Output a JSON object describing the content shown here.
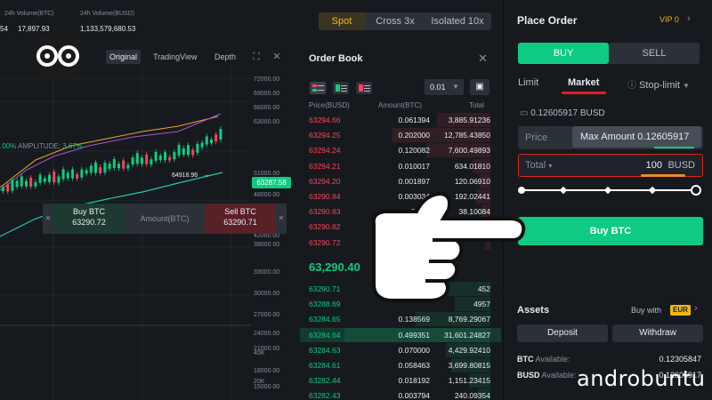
{
  "stats": {
    "change_fragment": "54",
    "low_label": "24h Volume(BTC)",
    "low_value": "17,897.93",
    "vol_label": "24h Volume(BUSD)",
    "vol_value": "1,133,579,680.53"
  },
  "chart_toolbar": {
    "tabs": [
      "Original",
      "TradingView",
      "Depth"
    ],
    "active_tab": "Original"
  },
  "chart": {
    "amplitude_prefix": ".00%",
    "amplitude_label": "AMPLITUDE:",
    "amplitude_value": "3.67%",
    "high_label": "64918.96",
    "last_price": "63287.58",
    "price_labels": [
      "72000.00",
      "69000.00",
      "66000.00",
      "63000.00",
      "51000.00",
      "48000.00",
      "45000.00",
      "42000.00",
      "39000.00",
      "33000.00",
      "30000.00",
      "27000.00",
      "24000.00",
      "21000.00",
      "18000.00",
      "15000.00",
      "40K",
      "20K"
    ],
    "quick_trade": {
      "buy_label": "Buy BTC",
      "buy_price": "63290.72",
      "amount_placeholder": "Amount(BTC)",
      "sell_label": "Sell BTC",
      "sell_price": "63290.71"
    }
  },
  "mode_tabs": [
    {
      "label": "Spot",
      "active": true
    },
    {
      "label": "Cross 3x",
      "active": false
    },
    {
      "label": "Isolated 10x",
      "active": false
    }
  ],
  "order_book": {
    "title": "Order Book",
    "precision": "0.01",
    "headers": [
      "Price(BUSD)",
      "Amount(BTC)",
      "Total"
    ],
    "mid_price": "63,290.40",
    "asks": [
      {
        "price": "63294.66",
        "amount": "0.061394",
        "total": "3,885.91236",
        "depth": 0.3
      },
      {
        "price": "63294.25",
        "amount": "0.202000",
        "total": "12,785.43850",
        "depth": 0.55
      },
      {
        "price": "63294.24",
        "amount": "0.120082",
        "total": "7,600.49893",
        "depth": 0.36
      },
      {
        "price": "63294.21",
        "amount": "0.010017",
        "total": "634.01810",
        "depth": 0.1
      },
      {
        "price": "63294.20",
        "amount": "0.001897",
        "total": "120.06910",
        "depth": 0.06
      },
      {
        "price": "63290.84",
        "amount": "0.003034",
        "total": "192.02441",
        "depth": 0.08
      },
      {
        "price": "63290.83",
        "amount": "0.001",
        "total": "38.10084",
        "depth": 0.05
      },
      {
        "price": "63290.82",
        "amount": "",
        "total": "",
        "depth": 0.04
      },
      {
        "price": "63290.72",
        "amount": "",
        "total": "",
        "depth": 0.03
      }
    ],
    "bids": [
      {
        "price": "63290.71",
        "amount": "",
        "total": "452",
        "depth": 0.35
      },
      {
        "price": "63288.69",
        "amount": "",
        "total": "4957",
        "depth": 0.2
      },
      {
        "price": "63284.65",
        "amount": "0.138569",
        "total": "8,769.29067",
        "depth": 0.42
      },
      {
        "price": "63284.64",
        "amount": "0.499351",
        "total": "31,601.24827",
        "depth": 0.82,
        "highlight": true
      },
      {
        "price": "63284.63",
        "amount": "0.070000",
        "total": "4,429.92410",
        "depth": 0.25
      },
      {
        "price": "63284.61",
        "amount": "0.058463",
        "total": "3,699.80815",
        "depth": 0.22
      },
      {
        "price": "63282.44",
        "amount": "0.018192",
        "total": "1,151.23415",
        "depth": 0.12
      },
      {
        "price": "63282.43",
        "amount": "0.003794",
        "total": "240.09354",
        "depth": 0.07
      }
    ]
  },
  "place_order": {
    "title": "Place Order",
    "vip": "VIP 0",
    "buy_tab": "BUY",
    "sell_tab": "SELL",
    "order_types": [
      "Limit",
      "Market",
      "Stop-limit"
    ],
    "active_order_type": "Market",
    "available": "0.12605917 BUSD",
    "price_label": "Price",
    "max_amount_tip": "Max Amount 0.12605917",
    "total_label": "Total",
    "total_value": "100",
    "total_unit": "BUSD",
    "slider_percent": 100,
    "buy_button": "Buy BTC"
  },
  "assets": {
    "title": "Assets",
    "buy_with": "Buy with",
    "currency": "EUR",
    "deposit": "Deposit",
    "withdraw": "Withdraw",
    "btc_label": "BTC",
    "btc_available_label": "Available:",
    "btc_value": "0.12305847",
    "busd_label": "BUSD",
    "busd_available_label": "Available:",
    "busd_value": "0.12605917"
  },
  "watermark": "androbuntu",
  "colors": {
    "background": "#161a1e",
    "green": "#0ecb81",
    "red": "#f6465d",
    "yellow": "#f0b90b",
    "panel": "#2b3139"
  },
  "icons": [
    "logo-icon",
    "expand-icon",
    "close-icon",
    "view-both-icon",
    "view-bids-icon",
    "view-asks-icon",
    "more-icon",
    "info-icon",
    "wallet-icon",
    "hand-pointer-icon",
    "chevron-right-icon",
    "dropdown-icon"
  ]
}
